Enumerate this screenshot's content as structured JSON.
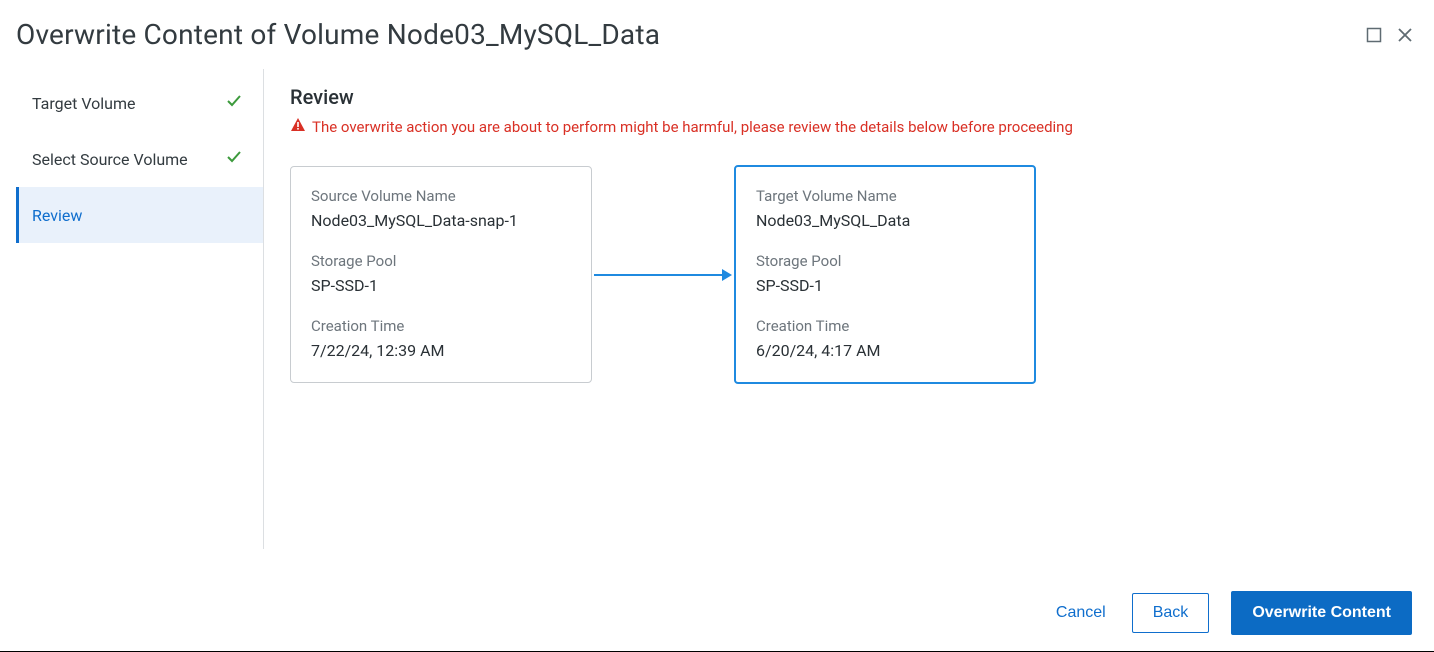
{
  "header": {
    "title": "Overwrite Content of Volume Node03_MySQL_Data"
  },
  "steps": {
    "items": [
      {
        "label": "Target Volume",
        "done": true,
        "active": false
      },
      {
        "label": "Select Source Volume",
        "done": true,
        "active": false
      },
      {
        "label": "Review",
        "done": false,
        "active": true
      }
    ]
  },
  "main": {
    "step_title": "Review",
    "warning_text": "The overwrite action you are about to perform might be harmful, please review the details below before proceeding",
    "source": {
      "labels": {
        "name": "Source Volume Name",
        "pool": "Storage Pool",
        "ctime": "Creation Time"
      },
      "values": {
        "name": "Node03_MySQL_Data-snap-1",
        "pool": "SP-SSD-1",
        "ctime": "7/22/24, 12:39 AM"
      }
    },
    "target": {
      "labels": {
        "name": "Target Volume Name",
        "pool": "Storage Pool",
        "ctime": "Creation Time"
      },
      "values": {
        "name": "Node03_MySQL_Data",
        "pool": "SP-SSD-1",
        "ctime": "6/20/24, 4:17 AM"
      }
    }
  },
  "footer": {
    "cancel": "Cancel",
    "back": "Back",
    "primary": "Overwrite Content"
  }
}
